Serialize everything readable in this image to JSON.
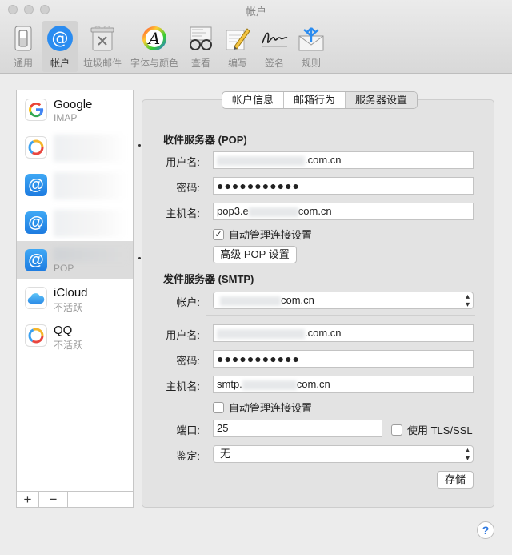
{
  "window": {
    "title": "帐户"
  },
  "toolbar": {
    "items": [
      {
        "label": "通用",
        "icon": "switch-icon"
      },
      {
        "label": "帐户",
        "icon": "at-sign-icon",
        "active": true
      },
      {
        "label": "垃圾邮件",
        "icon": "trash-can-icon"
      },
      {
        "label": "字体与颜色",
        "icon": "font-color-icon"
      },
      {
        "label": "查看",
        "icon": "glasses-icon"
      },
      {
        "label": "编写",
        "icon": "pencil-icon"
      },
      {
        "label": "签名",
        "icon": "signature-icon"
      },
      {
        "label": "规则",
        "icon": "rules-envelope-icon"
      }
    ]
  },
  "accounts": [
    {
      "name": "Google",
      "sub": "IMAP",
      "icon": "google-icon"
    },
    {
      "name": "",
      "sub": "",
      "icon": "qq-mail-icon",
      "blurred": true
    },
    {
      "name": "",
      "sub": "",
      "icon": "at-sign-icon",
      "blurred": true
    },
    {
      "name": "",
      "sub": "",
      "icon": "at-sign-icon",
      "blurred": true
    },
    {
      "name": "",
      "sub": "POP",
      "icon": "at-sign-icon",
      "blurred": true,
      "selected": true
    },
    {
      "name": "iCloud",
      "sub": "不活跃",
      "icon": "icloud-icon"
    },
    {
      "name": "QQ",
      "sub": "不活跃",
      "icon": "qq-mail-icon"
    }
  ],
  "list_footer": {
    "add": "+",
    "remove": "−"
  },
  "tabs": [
    "帐户信息",
    "邮箱行为",
    "服务器设置"
  ],
  "incoming": {
    "section": "收件服务器 (POP)",
    "username_label": "用户名:",
    "username_suffix": ".com.cn",
    "password_label": "密码:",
    "password_value": "●●●●●●●●●●●",
    "host_label": "主机名:",
    "host_prefix": "pop3.e",
    "host_suffix": "com.cn",
    "auto_manage": "自动管理连接设置",
    "advanced_button": "高级 POP 设置"
  },
  "outgoing": {
    "section": "发件服务器 (SMTP)",
    "account_label": "帐户:",
    "account_suffix": "com.cn",
    "username_label": "用户名:",
    "username_suffix": ".com.cn",
    "password_label": "密码:",
    "password_value": "●●●●●●●●●●●",
    "host_label": "主机名:",
    "host_prefix": "smtp.",
    "host_suffix": "com.cn",
    "auto_manage": "自动管理连接设置",
    "port_label": "端口:",
    "port_value": "25",
    "tls_label": "使用 TLS/SSL",
    "auth_label": "鉴定:",
    "auth_value": "无",
    "save_button": "存储"
  },
  "help": "?"
}
